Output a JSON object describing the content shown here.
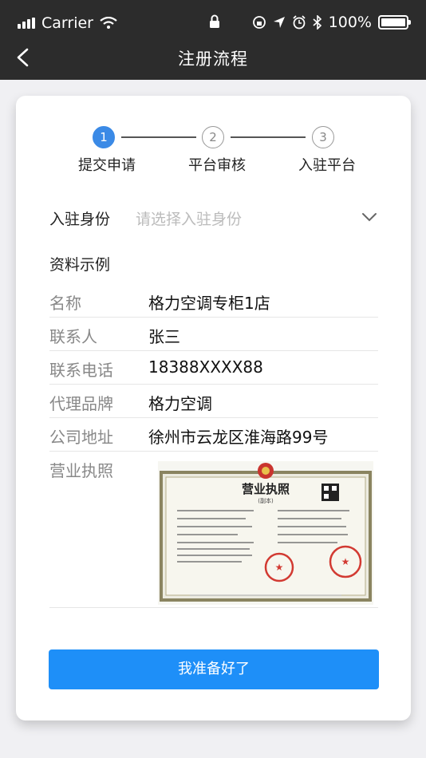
{
  "status_bar": {
    "carrier": "Carrier",
    "battery_percent": "100%"
  },
  "nav": {
    "title": "注册流程"
  },
  "steps": [
    {
      "number": "1",
      "label": "提交申请",
      "active": true
    },
    {
      "number": "2",
      "label": "平台审核",
      "active": false
    },
    {
      "number": "3",
      "label": "入驻平台",
      "active": false
    }
  ],
  "identity": {
    "label": "入驻身份",
    "placeholder": "请选择入驻身份"
  },
  "example": {
    "title": "资料示例",
    "rows": [
      {
        "key": "名称",
        "value": "格力空调专柜1店"
      },
      {
        "key": "联系人",
        "value": "张三"
      },
      {
        "key": "联系电话",
        "value": "18388XXXX88"
      },
      {
        "key": "代理品牌",
        "value": "格力空调"
      },
      {
        "key": "公司地址",
        "value": "徐州市云龙区淮海路99号"
      }
    ],
    "license_label": "营业执照",
    "license_title": "营业执照",
    "license_subtitle": "(副本)"
  },
  "cta_label": "我准备好了",
  "colors": {
    "accent": "#3b8ae6",
    "button": "#1e8ff8",
    "topbar": "#2c2c2c"
  }
}
